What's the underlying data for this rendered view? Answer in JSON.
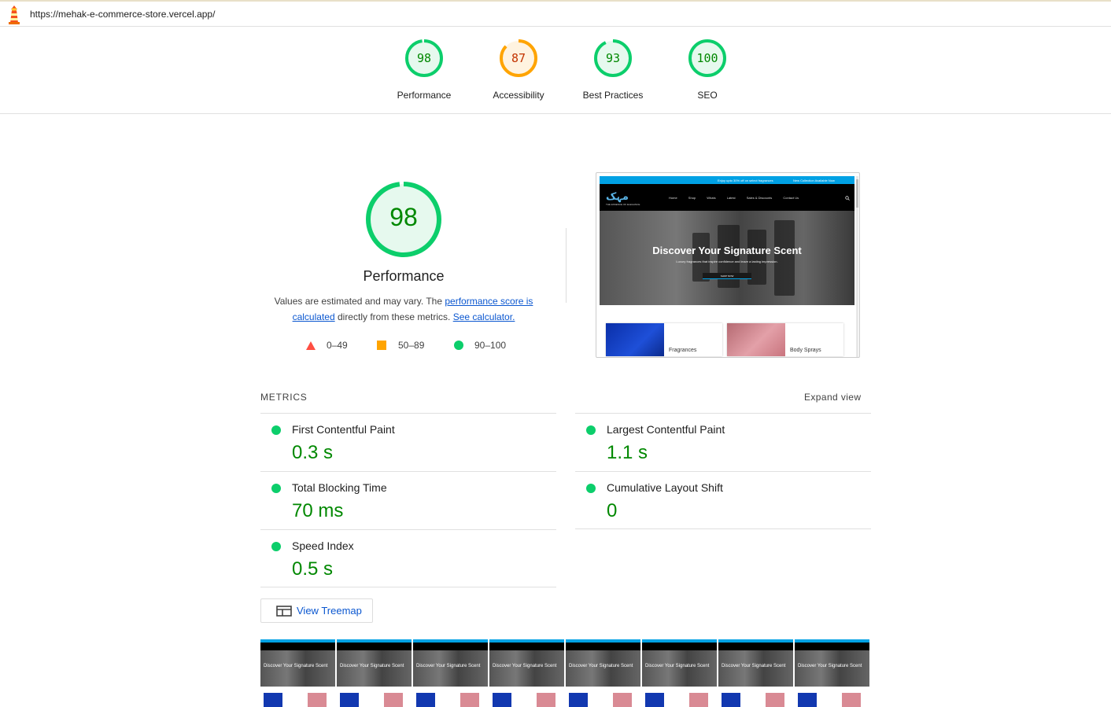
{
  "topbar": {
    "url": "https://mehak-e-commerce-store.vercel.app/",
    "logo_icon": "lighthouse-icon"
  },
  "categories": [
    {
      "label": "Performance",
      "score": 98,
      "color": "#0cce6b",
      "text_color": "#008800",
      "fill": "#e6f9ee"
    },
    {
      "label": "Accessibility",
      "score": 87,
      "color": "#ffa400",
      "text_color": "#c33300",
      "fill": "#fff3e0"
    },
    {
      "label": "Best Practices",
      "score": 93,
      "color": "#0cce6b",
      "text_color": "#008800",
      "fill": "#e6f9ee"
    },
    {
      "label": "SEO",
      "score": 100,
      "color": "#0cce6b",
      "text_color": "#008800",
      "fill": "#e6f9ee"
    }
  ],
  "performance": {
    "score": "98",
    "title": "Performance",
    "desc_prefix": "Values are estimated and may vary. The ",
    "desc_link1": "performance score is calculated",
    "desc_middle": " directly from these metrics. ",
    "desc_link2": "See calculator."
  },
  "legend": [
    {
      "range": "0–49",
      "shape": "triangle",
      "color": "#ff4e42"
    },
    {
      "range": "50–89",
      "shape": "square",
      "color": "#ffa400"
    },
    {
      "range": "90–100",
      "shape": "circle",
      "color": "#0cce6b"
    }
  ],
  "screenshot": {
    "promo_left": "Enjoy upto 30% off on select fragrances",
    "promo_right": "New Collection Available Now",
    "brand": "مہک",
    "brand_tag": "THE ESSENCE OF ELEGANCE",
    "nav_links": [
      "Home",
      "Shop",
      "Whats",
      "Latest",
      "Sales & Discounts",
      "Contact Us"
    ],
    "hero_title": "Discover Your Signature Scent",
    "hero_sub": "Luxury fragrances that inspire confidence and leave a lasting impression.",
    "hero_button": "SHOP NOW",
    "cat1": "Fragrances",
    "cat2": "Body Sprays"
  },
  "metrics": {
    "heading": "METRICS",
    "expand": "Expand view",
    "fcp_label": "First Contentful Paint",
    "fcp_value": "0.3 s",
    "lcp_label": "Largest Contentful Paint",
    "lcp_value": "1.1 s",
    "tbt_label": "Total Blocking Time",
    "tbt_value": "70 ms",
    "cls_label": "Cumulative Layout Shift",
    "cls_value": "0",
    "si_label": "Speed Index",
    "si_value": "0.5 s"
  },
  "treemap": {
    "label": "View Treemap",
    "icon": "treemap-icon"
  },
  "filmstrip": {
    "frame_title": "Discover Your Signature Scent"
  }
}
